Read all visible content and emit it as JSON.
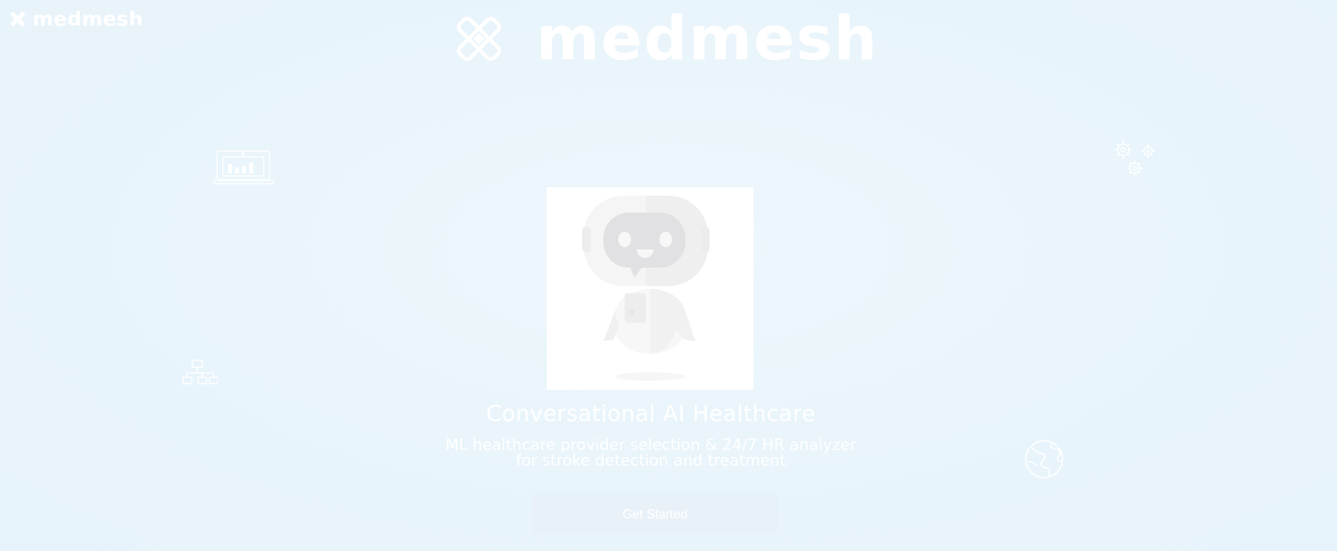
{
  "brand": {
    "name": "medmesh",
    "logo_icon": "bandage-cross-icon"
  },
  "hero": {
    "logo_text": "medmesh",
    "illustration": "robot-doctor-icon",
    "title": "Conversational AI Healthcare",
    "subtitle_line1": "ML healthcare provider selection  & 24/7 HR analyzer",
    "subtitle_line2": "for stroke detection and treatment",
    "cta_label": "Get Started"
  },
  "decorations": [
    "laptop-chart-icon",
    "gears-icon",
    "org-chart-icon",
    "globe-icon"
  ],
  "colors": {
    "background": "#e9f5fb",
    "text": "#ffffff",
    "button": "#e9f1f8"
  }
}
